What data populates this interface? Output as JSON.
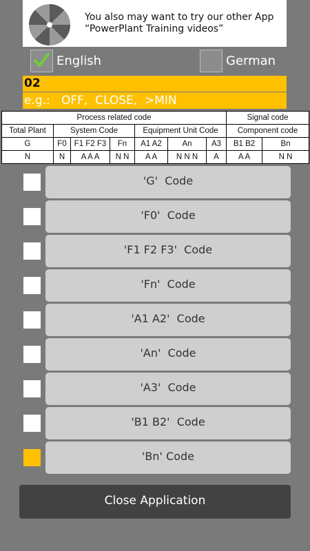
{
  "banner": {
    "line1": "You also may want to try our other App",
    "line2": "“PowerPlant Training videos”"
  },
  "language": {
    "english_label": "English",
    "german_label": "German",
    "english_checked": true,
    "german_checked": false
  },
  "code_value": "02",
  "example_text": "e.g.:   OFF,  CLOSE,  >MIN",
  "kks_table": {
    "group_process": "Process related code",
    "group_signal": "Signal code",
    "total_plant": "Total Plant",
    "system_code": "System Code",
    "equipment_code": "Equipment Unit Code",
    "component_code": "Component code",
    "letters": [
      "G",
      "F0",
      "F1 F2 F3",
      "Fn",
      "A1 A2",
      "An",
      "A3",
      "B1 B2",
      "Bn"
    ],
    "types": [
      "N",
      "N",
      "A A A",
      "N N",
      "A A",
      "N N N",
      "A",
      "A A",
      "N N"
    ]
  },
  "code_buttons": [
    {
      "label": "'G'  Code",
      "checked": false
    },
    {
      "label": "'F0'  Code",
      "checked": false
    },
    {
      "label": "'F1 F2 F3'  Code",
      "checked": false
    },
    {
      "label": "'Fn'  Code",
      "checked": false
    },
    {
      "label": "'A1 A2'  Code",
      "checked": false
    },
    {
      "label": "'An'  Code",
      "checked": false
    },
    {
      "label": "'A3'  Code",
      "checked": false
    },
    {
      "label": "'B1 B2'  Code",
      "checked": false
    },
    {
      "label": "'Bn' Code",
      "checked": true
    }
  ],
  "close_label": "Close Application",
  "colors": {
    "accent": "#ffc000",
    "background": "#7a7a7a",
    "button": "#cfcfcf",
    "close_button": "#424242",
    "check_green": "#6fcf3a"
  }
}
